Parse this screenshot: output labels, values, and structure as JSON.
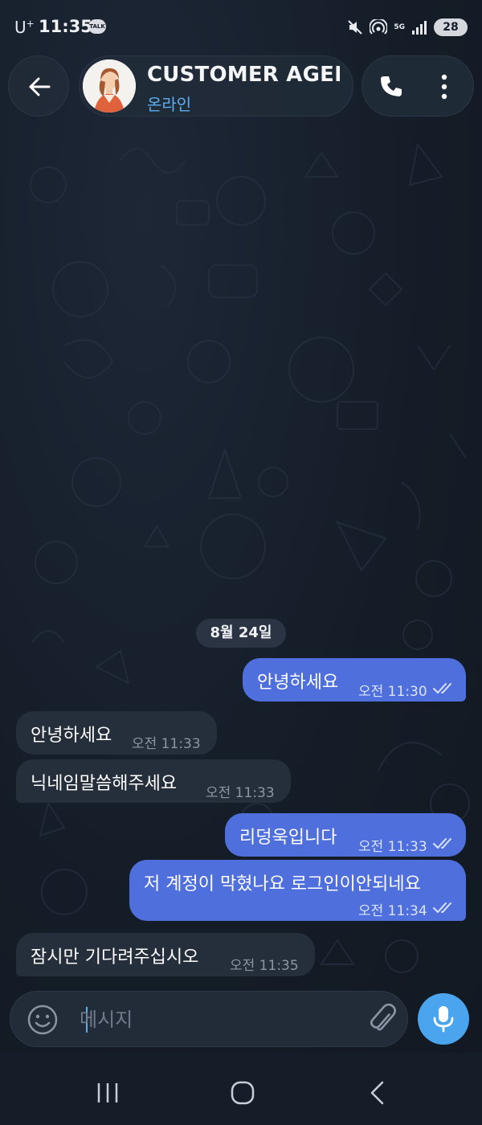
{
  "status_bar": {
    "carrier": "U",
    "carrier_sup": "+",
    "time": "11:35",
    "talk_badge": "TALK",
    "network": "5G",
    "battery": "28"
  },
  "header": {
    "title": "CUSTOMER AGEN",
    "status": "온라인",
    "icons": [
      "back-arrow-icon",
      "phone-icon",
      "more-vertical-icon"
    ]
  },
  "date_separator": "8월 24일",
  "messages": [
    {
      "direction": "outgoing",
      "text": "안녕하세요",
      "time": "오전 11:30",
      "read": true
    },
    {
      "direction": "incoming",
      "text": "안녕하세요",
      "time": "오전 11:33"
    },
    {
      "direction": "incoming",
      "text": "닉네임말씀해주세요",
      "time": "오전 11:33"
    },
    {
      "direction": "outgoing",
      "text": "리덩욱입니다",
      "time": "오전 11:33",
      "read": true
    },
    {
      "direction": "outgoing",
      "text": "저 계정이 막혔나요 로그인이안되네요",
      "time": "오전 11:34",
      "read": true
    },
    {
      "direction": "incoming",
      "text": "잠시만 기다려주십시오",
      "time": "오전 11:35"
    }
  ],
  "composer": {
    "placeholder": "메시지",
    "value": ""
  },
  "colors": {
    "background": "#151d29",
    "outgoing_bubble": "#4f6fdc",
    "incoming_bubble": "#252e3b",
    "accent": "#4aa4ee",
    "online_status": "#5eaef0"
  }
}
